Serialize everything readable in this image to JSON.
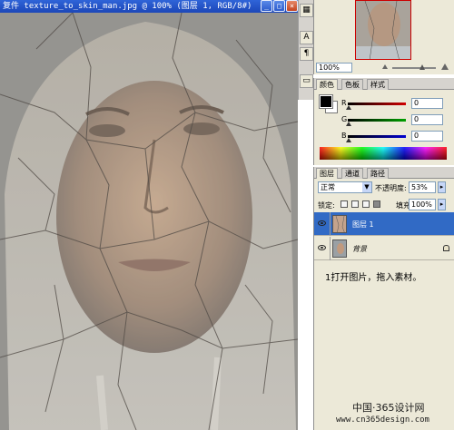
{
  "document": {
    "title": "复件 texture_to_skin_man.jpg @ 100% (图层 1, RGB/8#)"
  },
  "navigator": {
    "zoom_value": "100%"
  },
  "color_panel": {
    "tabs": [
      "颜色",
      "色板",
      "样式"
    ],
    "channels": [
      {
        "label": "R",
        "value": "0",
        "color": "#d00000"
      },
      {
        "label": "G",
        "value": "0",
        "color": "#00a000"
      },
      {
        "label": "B",
        "value": "0",
        "color": "#0000d0"
      }
    ]
  },
  "layers_panel": {
    "tabs": [
      "图层",
      "通道",
      "路径"
    ],
    "blend_mode": "正常",
    "opacity_label": "不透明度:",
    "opacity_value": "53%",
    "lock_label": "锁定:",
    "fill_label": "填充:",
    "fill_value": "100%",
    "layers": [
      {
        "name": "图层 1",
        "selected": true
      },
      {
        "name": "背景",
        "selected": false,
        "locked": true
      }
    ],
    "instruction": "1打开图片，拖入素材。"
  },
  "watermark": {
    "cn": "中国·365设计网",
    "url": "www.cn365design.com"
  }
}
